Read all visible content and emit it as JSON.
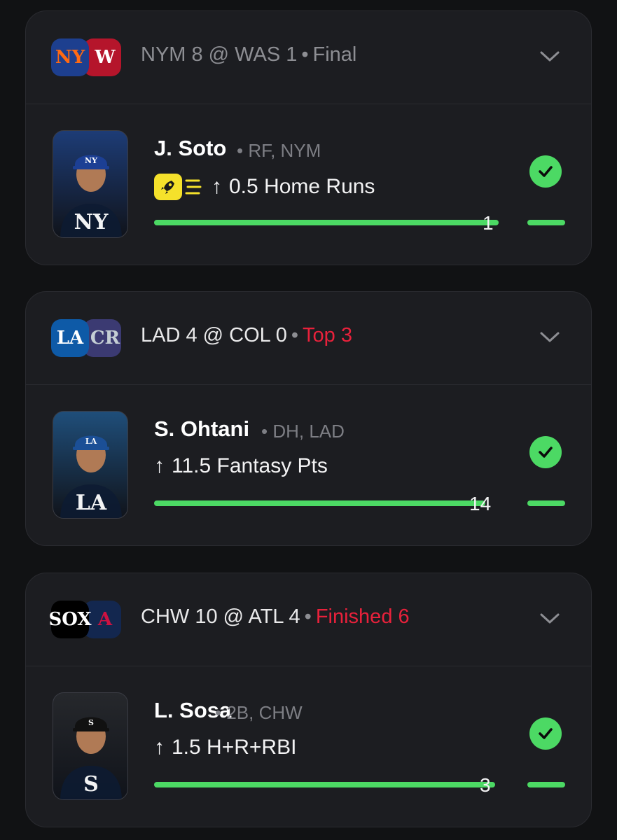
{
  "cards": [
    {
      "away_abbr": "NY",
      "home_abbr": "W",
      "matchup": "NYM 8 @ WAS 1",
      "separator": "•",
      "status": "Final",
      "status_live": false,
      "player_name": "J. Soto",
      "player_meta": "• RF, NYM",
      "arrow": "↑",
      "stat": "0.5 Home Runs",
      "has_boost": true,
      "result_value": "1",
      "progress": 1.0,
      "away_colors": {
        "bg": "#1d3f8f",
        "fg": "#ff6a13"
      },
      "home_colors": {
        "bg": "#b5152b",
        "fg": "#ffffff"
      },
      "photo_bg": "#1d3c76",
      "cap_color": "#1c3f94",
      "hit": true
    },
    {
      "away_abbr": "LA",
      "home_abbr": "CR",
      "matchup": "LAD 4 @ COL 0",
      "separator": "•",
      "status": "Top 3",
      "status_live": true,
      "player_name": "S. Ohtani",
      "player_meta": "• DH, LAD",
      "arrow": "↑",
      "stat": "11.5 Fantasy Pts",
      "has_boost": false,
      "result_value": "14",
      "progress": 1.0,
      "away_colors": {
        "bg": "#0e5aa7",
        "fg": "#ffffff"
      },
      "home_colors": {
        "bg": "#3b3a72",
        "fg": "#c4ced4"
      },
      "photo_bg": "#1f4e7a",
      "cap_color": "#1b4f96",
      "hit": true
    },
    {
      "away_abbr": "SOX",
      "home_abbr": "A",
      "matchup": "CHW 10 @ ATL 4",
      "separator": "•",
      "status": "Finished 6",
      "status_live": true,
      "player_name": "L. Sosa",
      "player_meta": "• 2B, CHW",
      "arrow": "↑",
      "stat": "1.5 H+R+RBI",
      "has_boost": false,
      "result_value": "3",
      "progress": 1.0,
      "away_colors": {
        "bg": "#000000",
        "fg": "#ffffff"
      },
      "home_colors": {
        "bg": "#13274f",
        "fg": "#ce1141"
      },
      "photo_bg": "#26282c",
      "cap_color": "#111111",
      "hit": true
    }
  ],
  "accent_green": "#4cd964",
  "live_red": "#e8213b"
}
